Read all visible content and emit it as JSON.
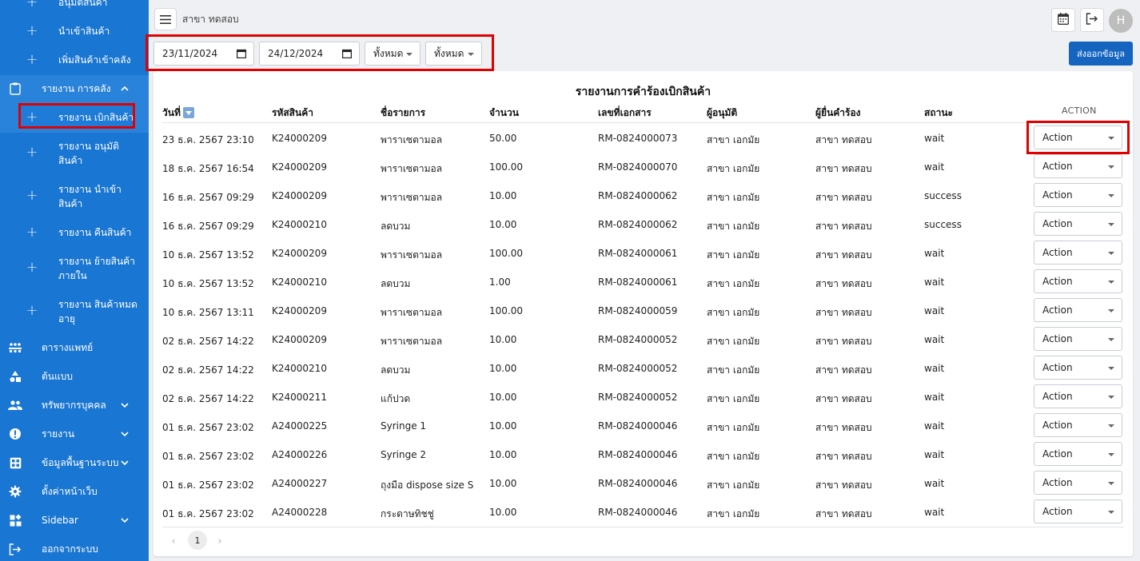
{
  "sidebar": {
    "items": [
      {
        "label": "อนุมัติสินค้า",
        "type": "sub"
      },
      {
        "label": "นำเข้าสินค้า",
        "type": "sub"
      },
      {
        "label": "เพิ่มสินค้าเข้าคลัง",
        "type": "sub"
      },
      {
        "label": "รายงาน การคลัง",
        "type": "group",
        "icon": "clipboard-icon"
      },
      {
        "label": "รายงาน เบิกสินค้า",
        "type": "sub"
      },
      {
        "label": "รายงาน อนุมัติสินค้า",
        "type": "sub"
      },
      {
        "label": "รายงาน นำเข้าสินค้า",
        "type": "sub"
      },
      {
        "label": "รายงาน คืนสินค้า",
        "type": "sub"
      },
      {
        "label": "รายงาน ย้ายสินค้าภายใน",
        "type": "sub"
      },
      {
        "label": "รายงาน สินค้าหมดอายุ",
        "type": "sub"
      },
      {
        "label": "ตารางแพทย์",
        "type": "main",
        "icon": "schedule-icon"
      },
      {
        "label": "ต้นแบบ",
        "type": "main",
        "icon": "shapes-icon"
      },
      {
        "label": "ทรัพยากรบุคคล",
        "type": "main",
        "icon": "people-icon"
      },
      {
        "label": "รายงาน",
        "type": "main",
        "icon": "alert-icon"
      },
      {
        "label": "ข้อมูลพื้นฐานระบบ",
        "type": "main",
        "icon": "grid-icon"
      },
      {
        "label": "ตั้งค่าหน้าเว็บ",
        "type": "main",
        "icon": "gear-icon"
      },
      {
        "label": "Sidebar",
        "type": "main",
        "icon": "widgets-icon"
      },
      {
        "label": "ออกจากระบบ",
        "type": "main",
        "icon": "logout-icon"
      }
    ]
  },
  "header": {
    "branch": "สาขา ทดสอบ",
    "avatar_letter": "H"
  },
  "filters": {
    "date_from": "23/11/2024",
    "date_to": "24/12/2024",
    "select1": "ทั้งหมด",
    "select2": "ทั้งหมด",
    "export_label": "ส่งออกข้อมูล"
  },
  "report": {
    "title": "รายงานการคำร้องเบิกสินค้า",
    "columns": [
      "วันที่",
      "รหัสสินค้า",
      "ชื่อรายการ",
      "จำนวน",
      "เลขที่เอกสาร",
      "ผู้อนุมัติ",
      "ผู้ยื่นคำร้อง",
      "สถานะ",
      "ACTION"
    ],
    "action_label": "Action",
    "rows": [
      [
        "23 ธ.ค. 2567 23:10",
        "K24000209",
        "พาราเซตามอล",
        "50.00",
        "RM-0824000073",
        "สาขา เอกมัย",
        "สาขา ทดสอบ",
        "wait"
      ],
      [
        "18 ธ.ค. 2567 16:54",
        "K24000209",
        "พาราเซตามอล",
        "100.00",
        "RM-0824000070",
        "สาขา เอกมัย",
        "สาขา ทดสอบ",
        "wait"
      ],
      [
        "16 ธ.ค. 2567 09:29",
        "K24000209",
        "พาราเซตามอล",
        "10.00",
        "RM-0824000062",
        "สาขา เอกมัย",
        "สาขา ทดสอบ",
        "success"
      ],
      [
        "16 ธ.ค. 2567 09:29",
        "K24000210",
        "ลดบวม",
        "10.00",
        "RM-0824000062",
        "สาขา เอกมัย",
        "สาขา ทดสอบ",
        "success"
      ],
      [
        "10 ธ.ค. 2567 13:52",
        "K24000209",
        "พาราเซตามอล",
        "100.00",
        "RM-0824000061",
        "สาขา เอกมัย",
        "สาขา ทดสอบ",
        "wait"
      ],
      [
        "10 ธ.ค. 2567 13:52",
        "K24000210",
        "ลดบวม",
        "1.00",
        "RM-0824000061",
        "สาขา เอกมัย",
        "สาขา ทดสอบ",
        "wait"
      ],
      [
        "10 ธ.ค. 2567 13:11",
        "K24000209",
        "พาราเซตามอล",
        "100.00",
        "RM-0824000059",
        "สาขา เอกมัย",
        "สาขา ทดสอบ",
        "wait"
      ],
      [
        "02 ธ.ค. 2567 14:22",
        "K24000209",
        "พาราเซตามอล",
        "10.00",
        "RM-0824000052",
        "สาขา เอกมัย",
        "สาขา ทดสอบ",
        "wait"
      ],
      [
        "02 ธ.ค. 2567 14:22",
        "K24000210",
        "ลดบวม",
        "10.00",
        "RM-0824000052",
        "สาขา เอกมัย",
        "สาขา ทดสอบ",
        "wait"
      ],
      [
        "02 ธ.ค. 2567 14:22",
        "K24000211",
        "แก้ปวด",
        "10.00",
        "RM-0824000052",
        "สาขา เอกมัย",
        "สาขา ทดสอบ",
        "wait"
      ],
      [
        "01 ธ.ค. 2567 23:02",
        "A24000225",
        "Syringe 1",
        "10.00",
        "RM-0824000046",
        "สาขา เอกมัย",
        "สาขา ทดสอบ",
        "wait"
      ],
      [
        "01 ธ.ค. 2567 23:02",
        "A24000226",
        "Syringe 2",
        "10.00",
        "RM-0824000046",
        "สาขา เอกมัย",
        "สาขา ทดสอบ",
        "wait"
      ],
      [
        "01 ธ.ค. 2567 23:02",
        "A24000227",
        "ถุงมือ dispose size S",
        "10.00",
        "RM-0824000046",
        "สาขา เอกมัย",
        "สาขา ทดสอบ",
        "wait"
      ],
      [
        "01 ธ.ค. 2567 23:02",
        "A24000228",
        "กระดาษทิชชู่",
        "10.00",
        "RM-0824000046",
        "สาขา เอกมัย",
        "สาขา ทดสอบ",
        "wait"
      ]
    ]
  },
  "pagination": {
    "current": "1",
    "prev": "‹",
    "next": "›"
  },
  "colors": {
    "sidebar": "#1976d2",
    "primary_button": "#1565c0",
    "highlight": "#e10000"
  }
}
